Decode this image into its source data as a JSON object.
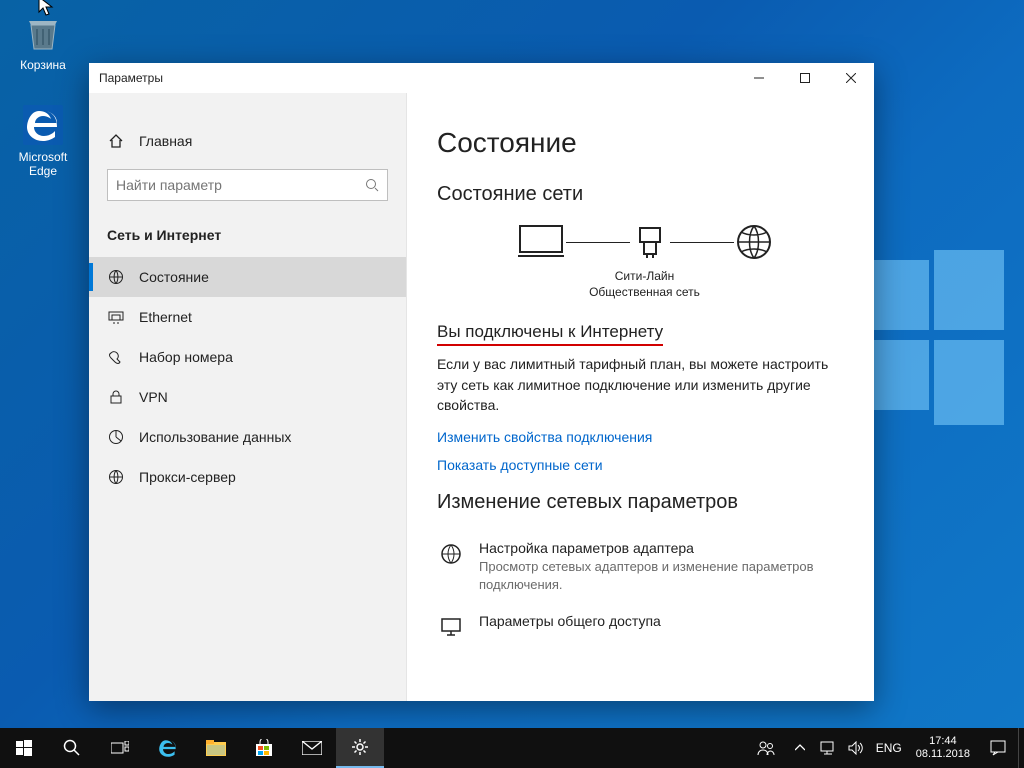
{
  "desktop": {
    "icons": [
      {
        "name": "recycle-bin",
        "label": "Корзина"
      },
      {
        "name": "edge",
        "label": "Microsoft Edge"
      }
    ]
  },
  "window": {
    "title": "Параметры",
    "home_label": "Главная",
    "search_placeholder": "Найти параметр",
    "section_title": "Сеть и Интернет",
    "nav": [
      {
        "key": "status",
        "label": "Состояние",
        "active": true
      },
      {
        "key": "ethernet",
        "label": "Ethernet"
      },
      {
        "key": "dialup",
        "label": "Набор номера"
      },
      {
        "key": "vpn",
        "label": "VPN"
      },
      {
        "key": "datausage",
        "label": "Использование данных"
      },
      {
        "key": "proxy",
        "label": "Прокси-сервер"
      }
    ],
    "main": {
      "page_title": "Состояние",
      "net_status_heading": "Состояние сети",
      "diagram": {
        "network_name": "Сити-Лайн",
        "network_type": "Общественная сеть"
      },
      "connected_heading": "Вы подключены к Интернету",
      "connected_body": "Если у вас лимитный тарифный план, вы можете настроить эту сеть как лимитное подключение или изменить другие свойства.",
      "link_change_props": "Изменить свойства подключения",
      "link_show_nets": "Показать доступные сети",
      "change_settings_heading": "Изменение сетевых параметров",
      "options": [
        {
          "key": "adapter",
          "title": "Настройка параметров адаптера",
          "desc": "Просмотр сетевых адаптеров и изменение параметров подключения."
        },
        {
          "key": "sharing",
          "title": "Параметры общего доступа",
          "desc": ""
        }
      ]
    }
  },
  "taskbar": {
    "lang": "ENG",
    "time": "17:44",
    "date": "08.11.2018"
  }
}
